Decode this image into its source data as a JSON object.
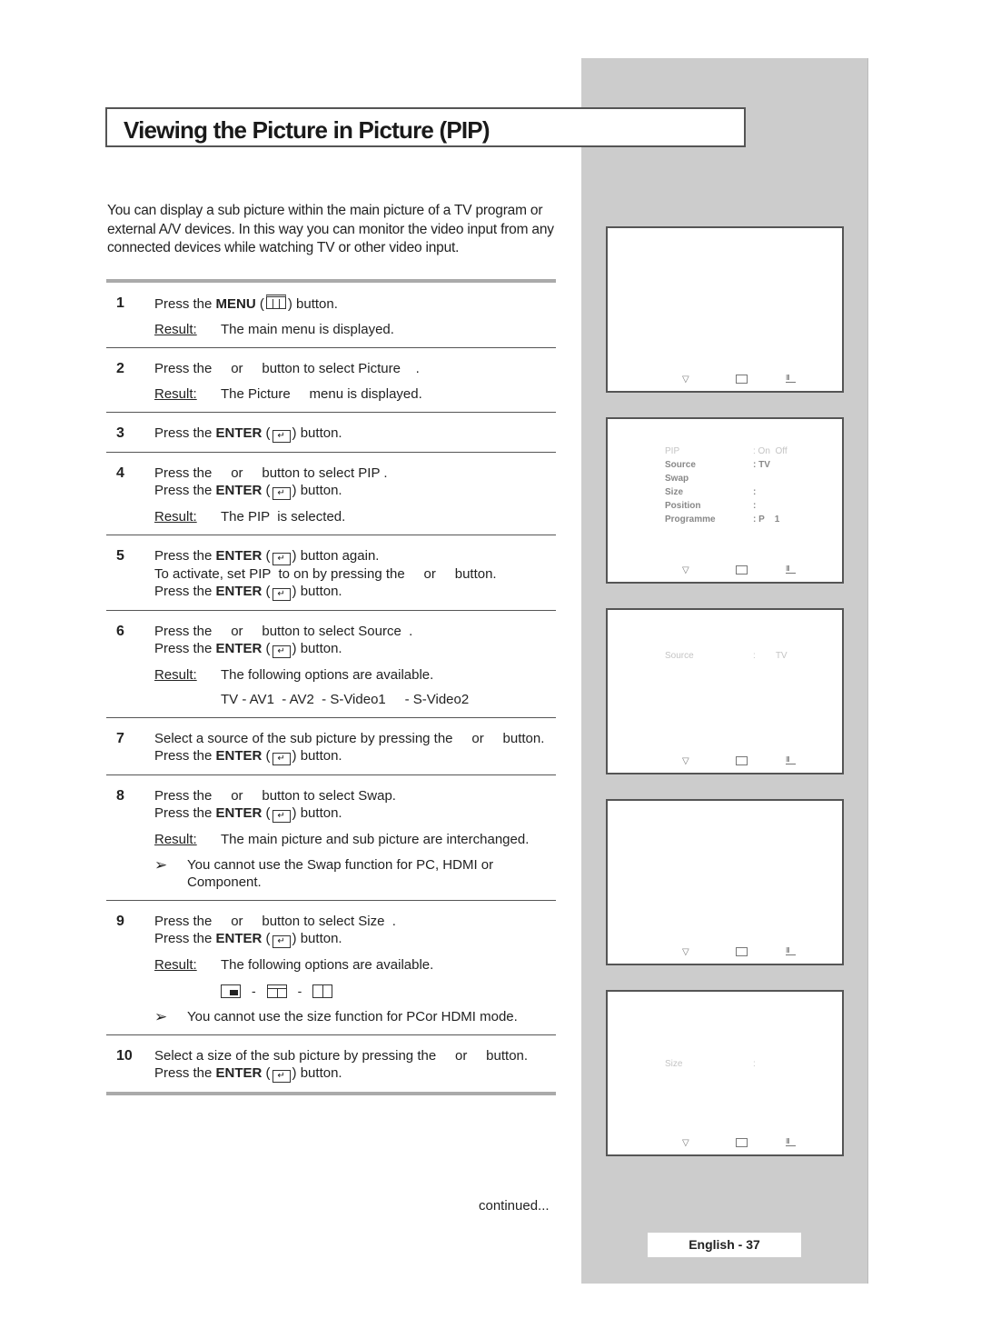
{
  "title": "Viewing the Picture in Picture (PIP)",
  "intro": "You can display a sub picture within the main picture of a TV program or external A/V devices. In this way you can monitor the video input from any connected devices while watching TV or other video input.",
  "labels": {
    "result": "Result:",
    "enter_prefix": "Press the ",
    "enter_key": "ENTER",
    "enter_suffix": " button.",
    "note_arrow": "➢"
  },
  "steps": [
    {
      "num": "1",
      "pre": "Press the ",
      "key": "MENU",
      "post": " button.",
      "result": "The main menu is displayed."
    },
    {
      "num": "2",
      "line1": "Press the     or     button to select Picture    .",
      "result": "The Picture     menu is displayed."
    },
    {
      "num": "3",
      "post": " button."
    },
    {
      "num": "4",
      "line1": "Press the     or     button to select PIP .",
      "result": "The PIP  is selected."
    },
    {
      "num": "5",
      "post": " button again.",
      "line2": "To activate, set PIP  to on by pressing the     or     button."
    },
    {
      "num": "6",
      "line1": "Press the     or     button to select Source  .",
      "result": "The following options are available.",
      "options": "TV - AV1  - AV2  - S-Video1     - S-Video2"
    },
    {
      "num": "7",
      "line1": "Select a source of the sub picture by pressing the     or     button."
    },
    {
      "num": "8",
      "line1": "Press the     or     button to select Swap.",
      "result": "The main picture and sub picture are interchanged.",
      "note": "You cannot use the Swap function for PC, HDMI or Component."
    },
    {
      "num": "9",
      "line1": "Press the     or     button to select Size  .",
      "result": "The following options are available.",
      "size_sep": "-",
      "note": "You cannot use the size function for PCor HDMI mode."
    },
    {
      "num": "10",
      "line1": "Select a size of the sub picture by pressing the     or     button."
    }
  ],
  "continued": "continued...",
  "screens": [
    {
      "rows": []
    },
    {
      "rows": [
        {
          "key": "PIP",
          "val": ": On",
          "extra": "Off",
          "faint": true
        },
        {
          "key": "Source",
          "val": ": TV"
        },
        {
          "key": "Swap",
          "val": ""
        },
        {
          "key": "Size",
          "val": ":"
        },
        {
          "key": "Position",
          "val": ":"
        },
        {
          "key": "Programme",
          "val": ": P    1"
        }
      ]
    },
    {
      "rows": [
        {
          "key": "Source",
          "val": ":",
          "extra": "TV",
          "faint": true
        }
      ]
    },
    {
      "rows": []
    },
    {
      "rows": [
        {
          "key": "Size",
          "val": ":",
          "faint": true
        }
      ]
    }
  ],
  "nav_icons": [
    "move-icon",
    "enter-icon",
    "return-icon"
  ],
  "page_label": "English - 37"
}
